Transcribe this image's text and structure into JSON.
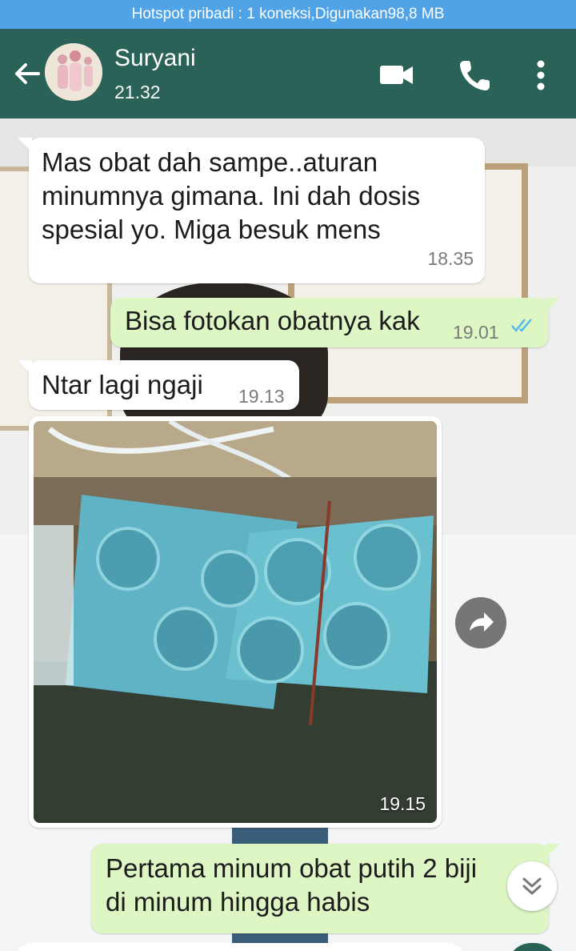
{
  "hotspot_text": "Hotspot pribadi : 1 koneksi,Digunakan98,8 MB",
  "header": {
    "contact_name": "Suryani",
    "last_seen": "21.32"
  },
  "messages": [
    {
      "text_lines": [
        "Mas obat dah sampe..aturan",
        "minumnya gimana. Ini dah dosis",
        "spesial yo. Miga besuk mens"
      ],
      "time": "18.35"
    },
    {
      "text": "Bisa fotokan obatnya kak",
      "time": "19.01"
    },
    {
      "text": "Ntar lagi ngaji",
      "time": "19.13"
    },
    {
      "time": "19.15"
    },
    {
      "text_lines": [
        "Pertama minum obat putih 2   biji",
        "di minum hingga habis"
      ]
    }
  ],
  "colors": {
    "header": "#2b6257",
    "hotspot_bar": "#4fa3e6",
    "outgoing_bubble": "#ddf6c4",
    "read_ticks": "#4fb6ec"
  },
  "icons": [
    "back-arrow-icon",
    "video-call-icon",
    "phone-icon",
    "more-vert-icon",
    "double-check-icon",
    "forward-icon",
    "chevron-double-down-icon"
  ]
}
